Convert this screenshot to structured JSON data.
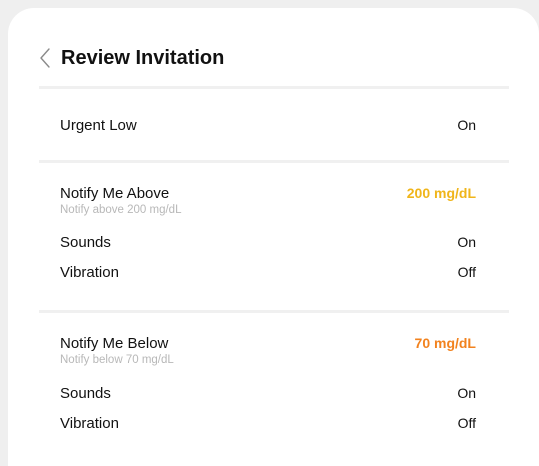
{
  "header": {
    "title": "Review Invitation"
  },
  "urgent_low": {
    "label": "Urgent Low",
    "value": "On"
  },
  "high_alert": {
    "label": "Notify Me Above",
    "value": "200 mg/dL",
    "value_color": "#f0b51a",
    "hint": "Notify above 200 mg/dL",
    "sounds_label": "Sounds",
    "sounds_value": "On",
    "vibration_label": "Vibration",
    "vibration_value": "Off"
  },
  "low_alert": {
    "label": "Notify Me Below",
    "value": "70 mg/dL",
    "value_color": "#f2821e",
    "hint": "Notify below 70 mg/dL",
    "sounds_label": "Sounds",
    "sounds_value": "On",
    "vibration_label": "Vibration",
    "vibration_value": "Off"
  },
  "icons": {
    "back": "chevron-left-icon"
  }
}
